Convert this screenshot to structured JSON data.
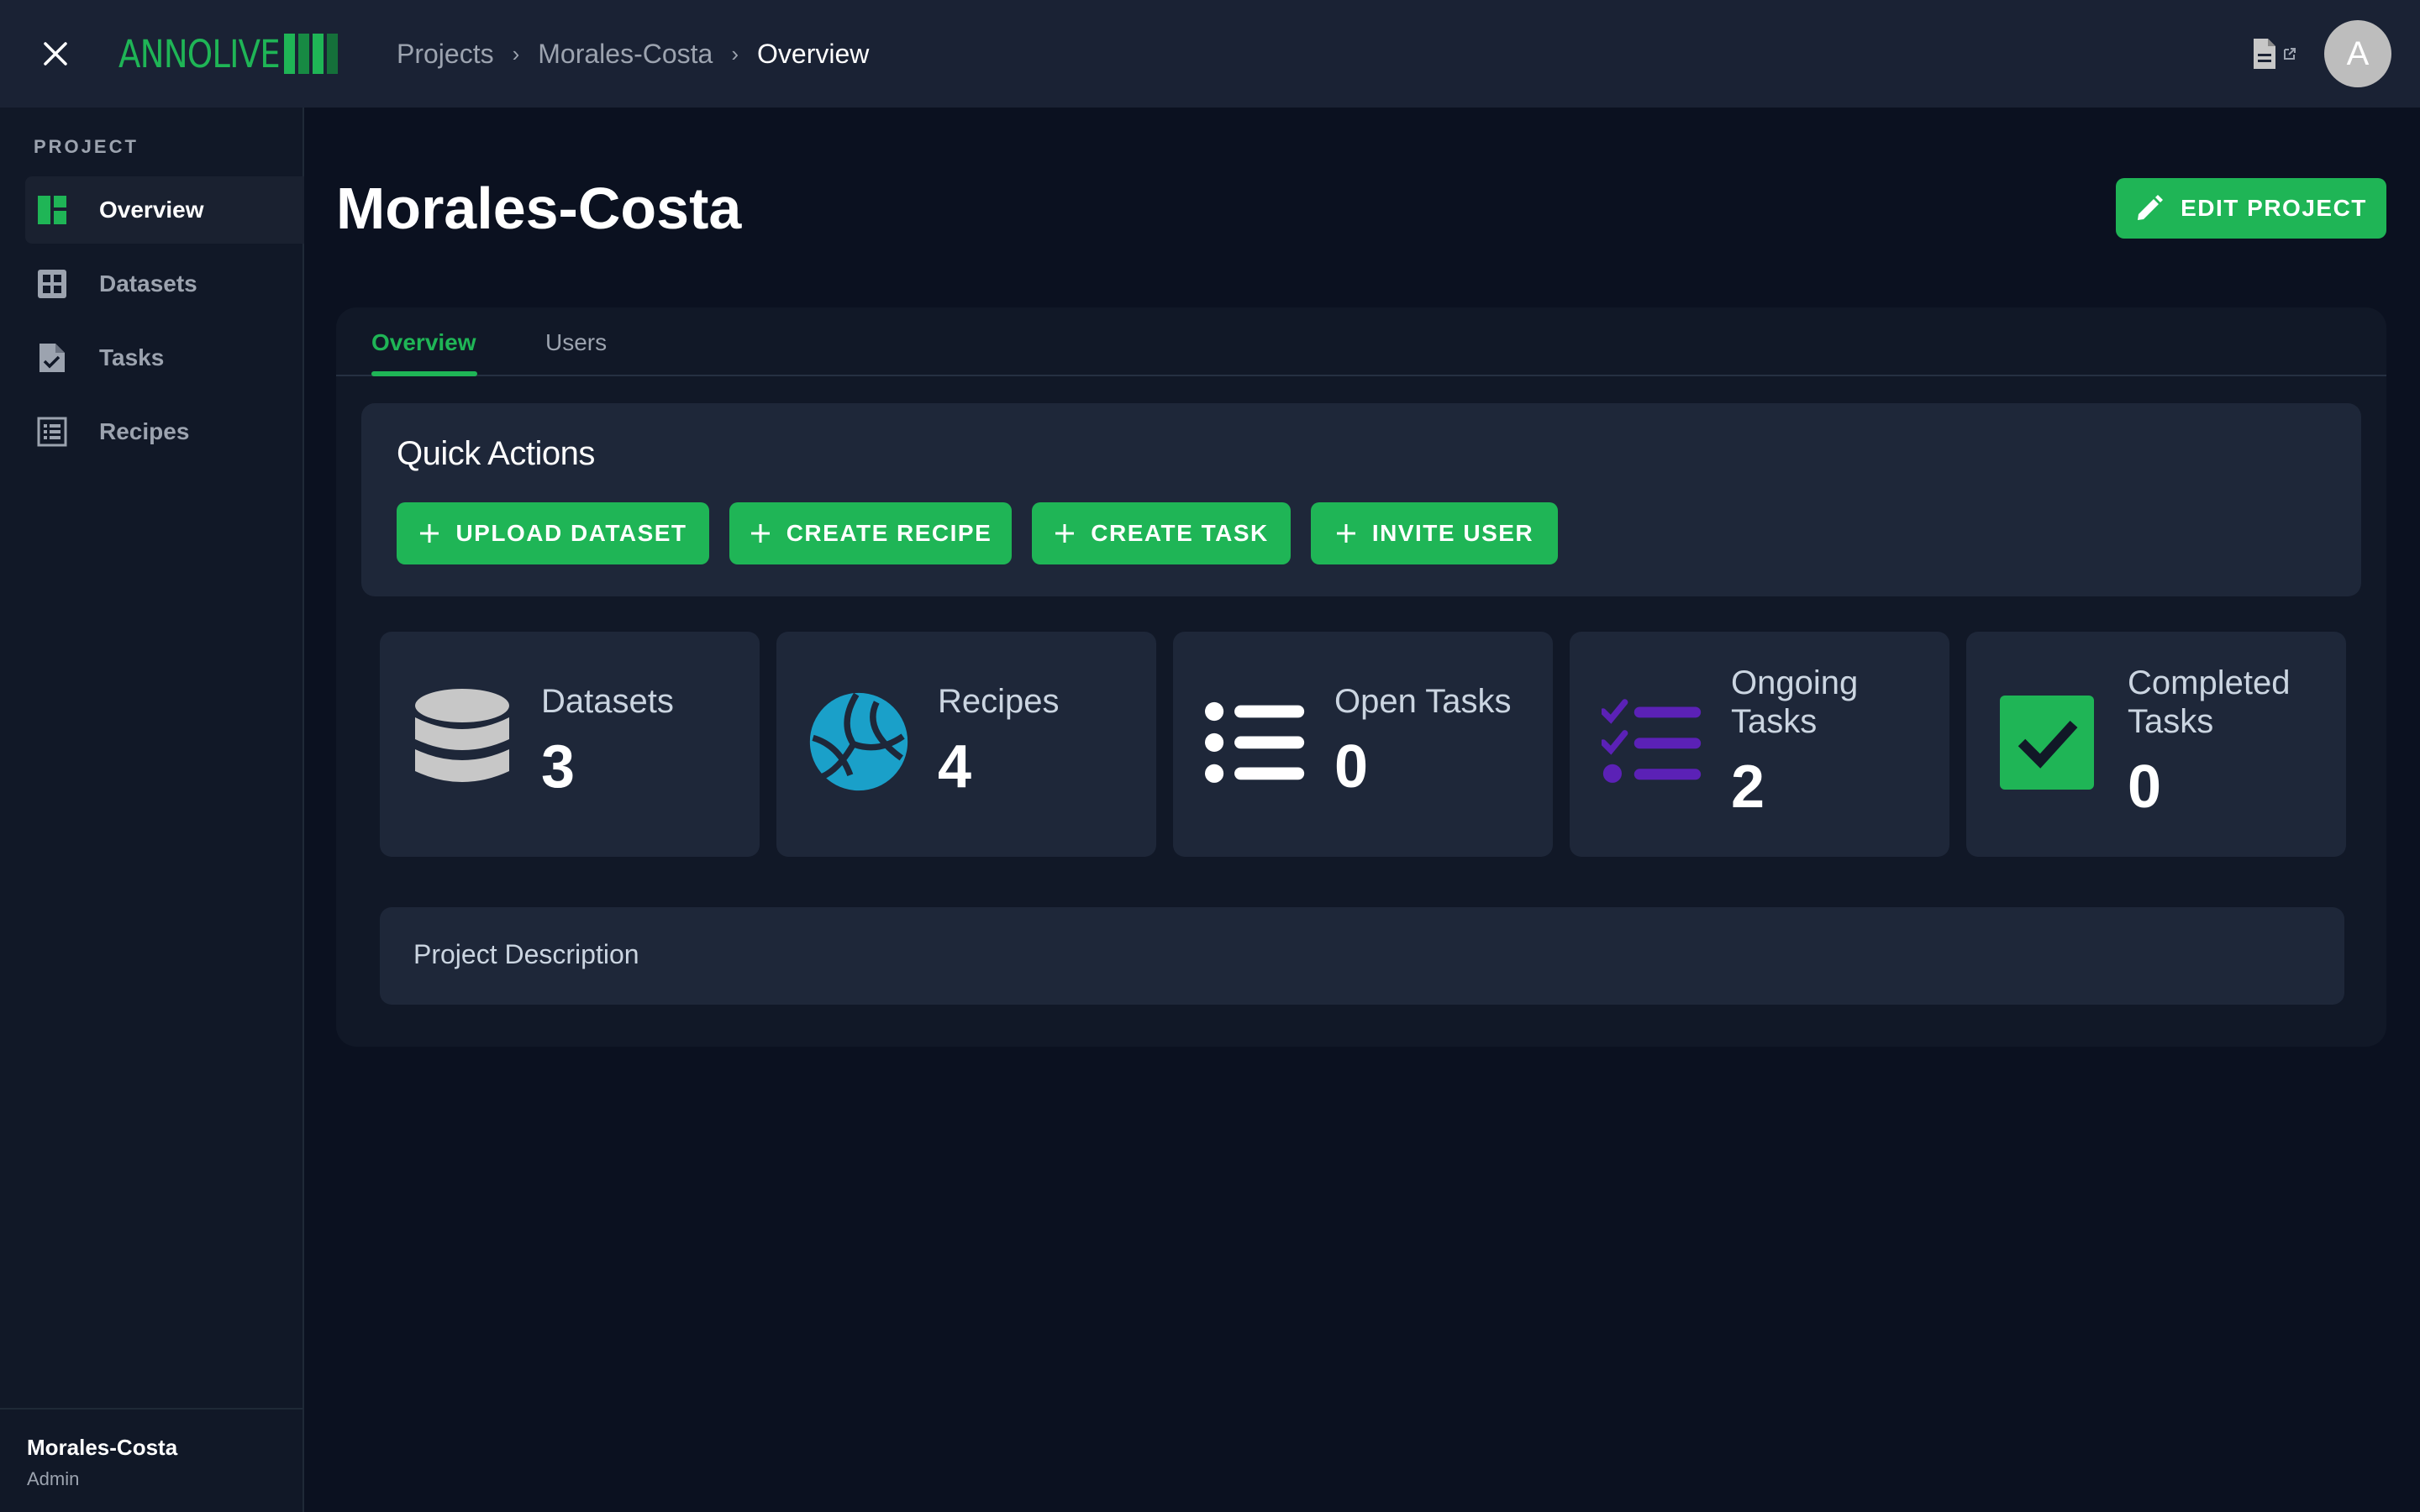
{
  "app": {
    "logo_text": "ANNOLIVE",
    "brand_color": "#1fb556"
  },
  "topbar": {
    "close_icon": "close-icon",
    "breadcrumb": [
      "Projects",
      "Morales-Costa",
      "Overview"
    ],
    "breadcrumb_separator": "›",
    "doc_icon": "document-external-link-icon",
    "avatar_initial": "A"
  },
  "sidebar": {
    "heading": "PROJECT",
    "items": [
      {
        "label": "Overview",
        "icon": "dashboard-icon",
        "active": true
      },
      {
        "label": "Datasets",
        "icon": "grid-icon",
        "active": false
      },
      {
        "label": "Tasks",
        "icon": "task-file-icon",
        "active": false
      },
      {
        "label": "Recipes",
        "icon": "list-icon",
        "active": false
      }
    ],
    "footer": {
      "name": "Morales-Costa",
      "role": "Admin"
    }
  },
  "main": {
    "title": "Morales-Costa",
    "edit_button": "EDIT PROJECT",
    "tabs": [
      {
        "label": "Overview",
        "active": true
      },
      {
        "label": "Users",
        "active": false
      }
    ],
    "quick_actions": {
      "title": "Quick Actions",
      "buttons": [
        "UPLOAD DATASET",
        "CREATE RECIPE",
        "CREATE TASK",
        "INVITE USER"
      ]
    },
    "stats": [
      {
        "label": "Datasets",
        "value": "3",
        "icon": "database-icon",
        "color": "#c7c7c7"
      },
      {
        "label": "Recipes",
        "value": "4",
        "icon": "volleyball-icon",
        "color": "#1aa0c9"
      },
      {
        "label": "Open Tasks",
        "value": "0",
        "icon": "bullet-list-icon",
        "color": "#ffffff"
      },
      {
        "label": "Ongoing Tasks",
        "value": "2",
        "icon": "checklist-icon",
        "color": "#5b21b6"
      },
      {
        "label": "Completed Tasks",
        "value": "0",
        "icon": "checkbox-icon",
        "color": "#1fb556"
      }
    ],
    "description_label": "Project Description"
  }
}
